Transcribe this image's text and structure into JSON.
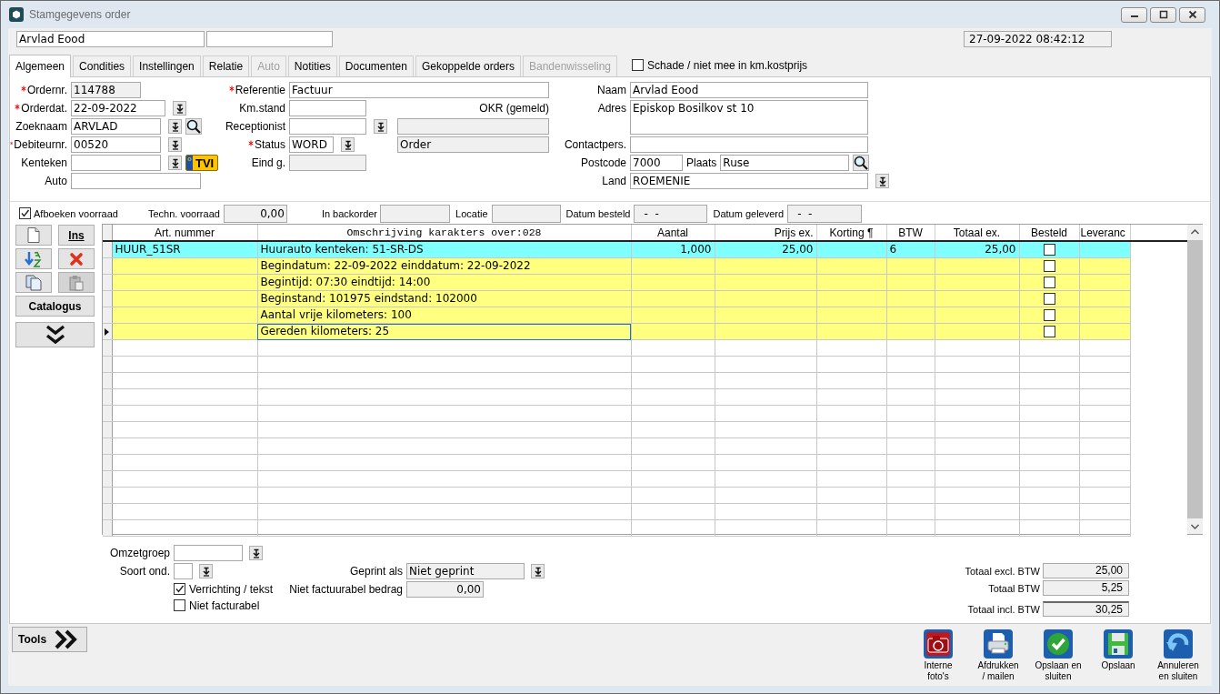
{
  "window": {
    "title": "Stamgegevens order"
  },
  "header": {
    "name": "Arvlad Eood",
    "datetime": "27-09-2022 08:42:12"
  },
  "tabs": [
    {
      "label": "Algemeen",
      "selected": true,
      "disabled": false
    },
    {
      "label": "Condities",
      "selected": false,
      "disabled": false
    },
    {
      "label": "Instellingen",
      "selected": false,
      "disabled": false
    },
    {
      "label": "Relatie",
      "selected": false,
      "disabled": false
    },
    {
      "label": "Auto",
      "selected": false,
      "disabled": true
    },
    {
      "label": "Notities",
      "selected": false,
      "disabled": false
    },
    {
      "label": "Documenten",
      "selected": false,
      "disabled": false
    },
    {
      "label": "Gekoppelde orders",
      "selected": false,
      "disabled": false
    },
    {
      "label": "Bandenwisseling",
      "selected": false,
      "disabled": true
    }
  ],
  "damage_checkbox": {
    "label": "Schade / niet mee in km.kostprijs",
    "checked": false
  },
  "form": {
    "left": [
      {
        "label": "Ordernr.",
        "required": true,
        "controls": [
          {
            "kind": "field",
            "value": "114788",
            "readonly": true
          }
        ]
      },
      {
        "label": "Orderdat.",
        "required": true,
        "controls": [
          {
            "kind": "field",
            "value": "22-09-2022",
            "readonly": false
          },
          {
            "kind": "dropdown"
          }
        ]
      },
      {
        "label": "Zoeknaam",
        "required": false,
        "controls": [
          {
            "kind": "field",
            "value": "ARVLAD",
            "readonly": false
          },
          {
            "kind": "dropdown"
          },
          {
            "kind": "search"
          }
        ]
      },
      {
        "label": "Debiteurnr.",
        "required": true,
        "controls": [
          {
            "kind": "field",
            "value": "00520",
            "readonly": false
          },
          {
            "kind": "dropdown"
          }
        ]
      },
      {
        "label": "Kenteken",
        "required": false,
        "controls": [
          {
            "kind": "field",
            "readonly": false
          },
          {
            "kind": "dropdown"
          },
          {
            "kind": "plate",
            "value": "TVI"
          }
        ]
      },
      {
        "label": "Auto",
        "required": false,
        "controls": [
          {
            "kind": "field",
            "readonly": false
          }
        ]
      }
    ],
    "middle": [
      {
        "label": "Referentie",
        "required": true,
        "controls": [
          {
            "kind": "field",
            "value": "Factuur",
            "readonly": false
          }
        ]
      },
      {
        "label": "Km.stand",
        "required": false,
        "controls": [
          {
            "kind": "field",
            "readonly": false
          },
          {
            "kind": "note",
            "value": "OKR (gemeld)"
          }
        ]
      },
      {
        "label": "Receptionist",
        "required": false,
        "controls": [
          {
            "kind": "field",
            "readonly": false
          },
          {
            "kind": "dropdown"
          },
          {
            "kind": "field",
            "readonly": true
          }
        ]
      },
      {
        "label": "Status",
        "required": true,
        "controls": [
          {
            "kind": "field",
            "value": "WORD",
            "readonly": false
          },
          {
            "kind": "dropdown"
          },
          {
            "kind": "field",
            "value": "Order",
            "readonly": true
          }
        ]
      },
      {
        "label": "Eind g.",
        "required": false,
        "controls": [
          {
            "kind": "field",
            "readonly": true
          }
        ]
      }
    ],
    "right": [
      {
        "label": "Naam",
        "required": false,
        "controls": [
          {
            "kind": "field",
            "value": "Arvlad Eood",
            "readonly": false
          }
        ]
      },
      {
        "label": "Adres",
        "required": false,
        "controls": [
          {
            "kind": "area",
            "value": "Episkop Bosilkov st 10",
            "readonly": false
          }
        ]
      },
      {
        "label": "Contactpers.",
        "required": false,
        "controls": [
          {
            "kind": "field",
            "readonly": false
          }
        ]
      },
      {
        "label": "Postcode",
        "required": false,
        "controls": [
          {
            "kind": "field",
            "value": "7000",
            "readonly": false
          },
          {
            "kind": "label",
            "value": "Plaats"
          },
          {
            "kind": "field",
            "value": "Ruse",
            "readonly": false
          },
          {
            "kind": "search"
          }
        ]
      },
      {
        "label": "Land",
        "required": false,
        "controls": [
          {
            "kind": "field",
            "value": "ROEMENIE",
            "readonly": false
          },
          {
            "kind": "dropdown"
          }
        ]
      }
    ]
  },
  "stock": {
    "checkbox": {
      "label": "Afboeken voorraad",
      "checked": true
    },
    "fields": [
      {
        "label": "Techn. voorraad",
        "value": "0,00"
      },
      {
        "label": "In backorder"
      },
      {
        "label": "Locatie"
      },
      {
        "label": "Datum besteld",
        "value": "-  -"
      },
      {
        "label": "Datum geleverd",
        "value": "-  -"
      }
    ]
  },
  "table_toolbar": {
    "insert_label": "Ins",
    "catalog_label": "Catalogus"
  },
  "table": {
    "columns": [
      "Art. nummer",
      "Omschrijving karakters over:028",
      "Aantal",
      "Prijs ex.",
      "Korting ¶",
      "BTW",
      "Totaal ex.",
      "Besteld",
      "Leveranc"
    ],
    "rows": [
      {
        "kind": "article",
        "art": "HUUR_51SR",
        "description": "Huurauto kenteken: 51-SR-DS",
        "quantity": "1,000",
        "price": "25,00",
        "btw": "6",
        "total": "25,00",
        "ordered": false,
        "current": false
      },
      {
        "kind": "text",
        "description": "Begindatum: 22-09-2022 einddatum: 22-09-2022",
        "ordered": false,
        "current": false
      },
      {
        "kind": "text",
        "description": "Begintijd: 07:30 eindtijd: 14:00",
        "ordered": false,
        "current": false
      },
      {
        "kind": "text",
        "description": "Beginstand: 101975 eindstand: 102000",
        "ordered": false,
        "current": false
      },
      {
        "kind": "text",
        "description": "Aantal vrije kilometers: 100",
        "ordered": false,
        "current": false
      },
      {
        "kind": "text",
        "description": "Gereden kilometers: 25",
        "ordered": false,
        "current": true
      }
    ]
  },
  "bottom": {
    "revenue_group": {
      "label": "Omzetgroep"
    },
    "order_type": {
      "label": "Soort ond."
    },
    "printed_as": {
      "label": "Geprint als",
      "value": "Niet geprint"
    },
    "service_text": {
      "label": "Verrichting / tekst",
      "checked": true
    },
    "non_billable_amount": {
      "label": "Niet factuurabel bedrag",
      "value": "0,00"
    },
    "not_billable": {
      "label": "Niet facturabel",
      "checked": false
    }
  },
  "totals": [
    {
      "label": "Totaal excl. BTW",
      "value": "25,00"
    },
    {
      "label": "Totaal BTW",
      "value": "5,25"
    },
    {
      "label": "Totaal incl. BTW",
      "value": "30,25"
    }
  ],
  "footer": {
    "tools_label": "Tools",
    "actions": [
      {
        "kind": "camera",
        "label": "Interne\nfoto's"
      },
      {
        "kind": "print",
        "label": "Afdrukken\n/ mailen"
      },
      {
        "kind": "save_close",
        "label": "Opslaan en\nsluiten"
      },
      {
        "kind": "save",
        "label": "Opslaan"
      },
      {
        "kind": "cancel",
        "label": "Annuleren\nen sluiten"
      }
    ]
  }
}
